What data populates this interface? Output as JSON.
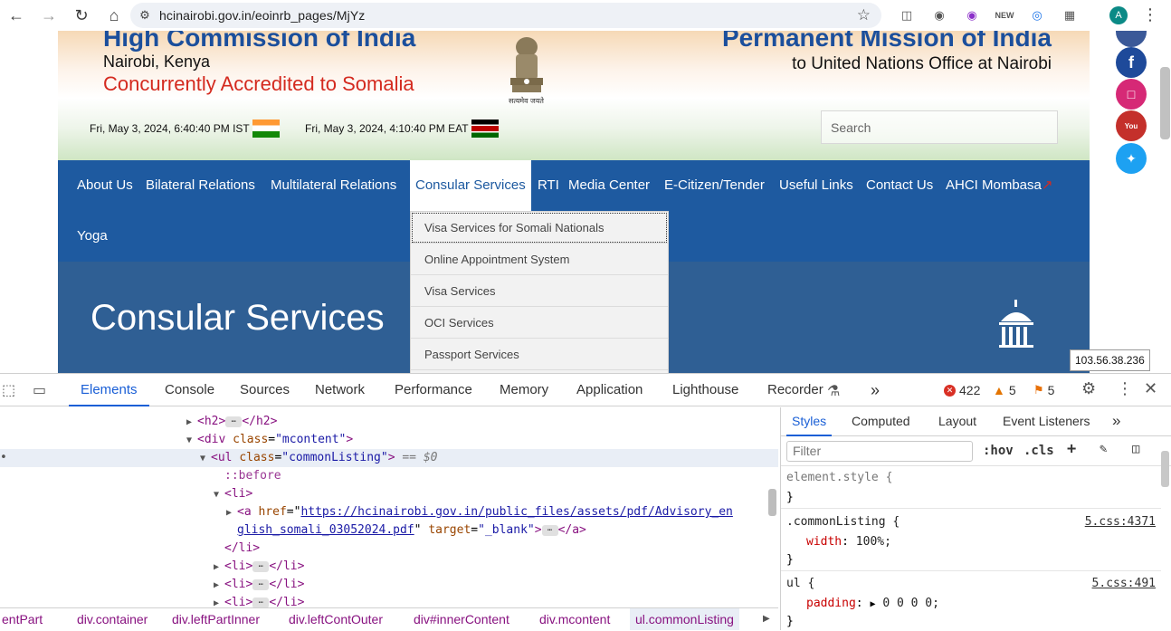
{
  "browser": {
    "url": "hcinairobi.gov.in/eoinrb_pages/MjYz",
    "avatar_letter": "A",
    "icons": [
      "back-icon",
      "forward-icon",
      "reload-icon",
      "home-icon",
      "site-info-icon",
      "bookmark-star-icon"
    ]
  },
  "header": {
    "hc_title": "High Commission of India",
    "hc_city": "Nairobi, Kenya",
    "hc_accredited": "Concurrently Accredited to Somalia",
    "pm_title": "Permanent Mission of India",
    "pm_subtitle": "to United Nations Office at Nairobi",
    "emblem_caption": "सत्यमेव जयते",
    "time_ist": "Fri, May 3, 2024, 6:40:40 PM IST",
    "time_eat": "Fri, May 3, 2024, 4:10:40 PM EAT",
    "search_placeholder": "Search"
  },
  "nav": {
    "items": [
      "About Us",
      "Bilateral Relations",
      "Multilateral Relations",
      "Consular Services",
      "RTI",
      "Media Center",
      "E-Citizen/Tender",
      "Useful Links",
      "Contact Us",
      "AHCI Mombasa",
      "Yoga"
    ],
    "active": "Consular Services",
    "external_mark": "↗"
  },
  "dropdown": {
    "items": [
      "Visa Services for Somali Nationals",
      "Online Appointment System",
      "Visa Services",
      "OCI Services",
      "Passport Services"
    ]
  },
  "banner": {
    "title": "Consular Services"
  },
  "ip_tooltip": "103.56.38.236",
  "devtools": {
    "tabs": [
      "Elements",
      "Console",
      "Sources",
      "Network",
      "Performance",
      "Memory",
      "Application",
      "Lighthouse",
      "Recorder"
    ],
    "more": "»",
    "errors": "422",
    "warnings": "5",
    "issues": "5",
    "dom": {
      "l1_tag": "<h2>",
      "l1_close": "</h2>",
      "l2_open": "<div",
      "l2_attr": "class",
      "l2_val": "\"mcontent\"",
      "l2_end": ">",
      "l3_open": "<ul",
      "l3_attr": "class",
      "l3_val": "\"commonListing\"",
      "l3_end": ">",
      "l3_marker": "== $0",
      "l4": "::before",
      "l5": "<li>",
      "l6_open": "<a",
      "l6_href_attr": "href",
      "l6_href_a": "https://hcinairobi.gov.in/public_files/assets/pdf/Advisory_en",
      "l7_href_b": "glish_somali_03052024.pdf",
      "l7_target_attr": "target",
      "l7_target_val": "\"_blank\"",
      "l7_end": ">",
      "l7_close": "</a>",
      "l8": "</li>",
      "li_open": "<li>",
      "li_close": "</li>"
    },
    "breadcrumbs": [
      "entPart",
      "div.container",
      "div.leftPartInner",
      "div.leftContOuter",
      "div#innerContent",
      "div.mcontent",
      "ul.commonListing"
    ],
    "styles_tabs": [
      "Styles",
      "Computed",
      "Layout",
      "Event Listeners"
    ],
    "filter_placeholder": "Filter",
    "hov": ":hov",
    "cls": ".cls",
    "rules": {
      "r1_selector": "element.style {",
      "r1_close": "}",
      "r2_selector": ".commonListing {",
      "r2_source": "5.css:4371",
      "r2_prop": "width",
      "r2_val": "100%;",
      "r2_close": "}",
      "r3_selector": "ul {",
      "r3_source": "5.css:491",
      "r3_prop": "padding",
      "r3_val": "0 0 0 0;",
      "r3_close": "}"
    }
  },
  "colors": {
    "nav_blue": "#1e5aa0",
    "accent_blue": "#1a5fd6",
    "accent_red": "#d42a1f"
  }
}
